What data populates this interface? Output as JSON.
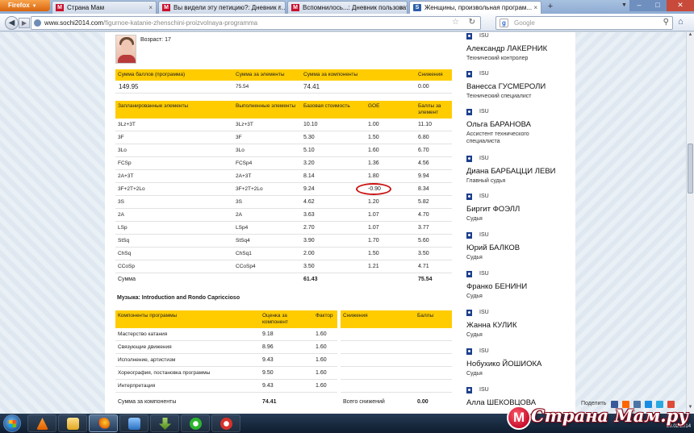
{
  "browser": {
    "menu_label": "Firefox",
    "tabs": [
      {
        "label": "Страна Мам",
        "favicon": "M"
      },
      {
        "label": "Вы видели эту петицию?: Дневник г...",
        "favicon": "M"
      },
      {
        "label": "Вспомнилось...: Дневник пользоват...",
        "favicon": "M"
      },
      {
        "label": "Женщины, произвольная програм...",
        "favicon": "S"
      }
    ],
    "new_tab": "+",
    "url_domain": "www.sochi2014.com",
    "url_path": "/figurnoe-katanie-zhenschini-proizvolnaya-programma",
    "search_placeholder": "Google",
    "search_engine_icon": "g-icon"
  },
  "athlete": {
    "age_label": "Возраст: 17"
  },
  "summary": {
    "headers": [
      "Сумма баллов (программа)",
      "Сумма за элементы",
      "Сумма за компоненты",
      "Снижения"
    ],
    "values": [
      "149.95",
      "75.54",
      "74.41",
      "0.00"
    ]
  },
  "elements": {
    "headers": [
      "Запланированные элементы",
      "Выполненные элементы",
      "Базовая стоимость",
      "GOE",
      "Баллы за элемент"
    ],
    "rows": [
      [
        "3Lz+3T",
        "3Lz+3T",
        "10.10",
        "1.00",
        "11.10"
      ],
      [
        "3F",
        "3F",
        "5.30",
        "1.50",
        "6.80"
      ],
      [
        "3Lo",
        "3Lo",
        "5.10",
        "1.60",
        "6.70"
      ],
      [
        "FCSp",
        "FCSp4",
        "3.20",
        "1.36",
        "4.56"
      ],
      [
        "2A+3T",
        "2A+3T",
        "8.14",
        "1.80",
        "9.94"
      ],
      [
        "3F+2T+2Lo",
        "3F+2T+2Lo",
        "9.24",
        "-0.90",
        "8.34"
      ],
      [
        "3S",
        "3S",
        "4.62",
        "1.20",
        "5.82"
      ],
      [
        "2A",
        "2A",
        "3.63",
        "1.07",
        "4.70"
      ],
      [
        "LSp",
        "LSp4",
        "2.70",
        "1.07",
        "3.77"
      ],
      [
        "StSq",
        "StSq4",
        "3.90",
        "1.70",
        "5.60"
      ],
      [
        "ChSq",
        "ChSq1",
        "2.00",
        "1.50",
        "3.50"
      ],
      [
        "CCoSp",
        "CCoSp4",
        "3.50",
        "1.21",
        "4.71"
      ]
    ],
    "total_label": "Сумма",
    "total_base": "61.43",
    "total_score": "75.54"
  },
  "music": "Музыка: Introduction and Rondo Capriccioso",
  "components": {
    "headers": [
      "Компоненты программы",
      "Оценка за компонент",
      "Фактор"
    ],
    "rows": [
      [
        "Мастерство катания",
        "9.18",
        "1.60"
      ],
      [
        "Связующие движения",
        "8.96",
        "1.60"
      ],
      [
        "Исполнение, артистизм",
        "9.43",
        "1.60"
      ],
      [
        "Хореография, постановка программы",
        "9.50",
        "1.60"
      ],
      [
        "Интерпретация",
        "9.43",
        "1.60"
      ]
    ],
    "total_label": "Сумма за компоненты",
    "total_value": "74.41"
  },
  "deductions": {
    "headers": [
      "Снижения",
      "Баллы"
    ],
    "total_label": "Всего снижений",
    "total_value": "0.00"
  },
  "judges": [
    {
      "org": "ISU",
      "name": "Александр ЛАКЕРНИК",
      "role": "Технический контролер"
    },
    {
      "org": "ISU",
      "name": "Ванесса ГУСМЕРОЛИ",
      "role": "Технический специалист"
    },
    {
      "org": "ISU",
      "name": "Ольга БАРАНОВА",
      "role": "Ассистент технического специалиста"
    },
    {
      "org": "ISU",
      "name": "Диана БАРБАЦЦИ ЛЕВИ",
      "role": "Главный судья"
    },
    {
      "org": "ISU",
      "name": "Биргит ФОЭЛЛ",
      "role": "Судья"
    },
    {
      "org": "ISU",
      "name": "Юрий БАЛКОВ",
      "role": "Судья"
    },
    {
      "org": "ISU",
      "name": "Франко БЕНИНИ",
      "role": "Судья"
    },
    {
      "org": "ISU",
      "name": "Жанна КУЛИК",
      "role": "Судья"
    },
    {
      "org": "ISU",
      "name": "Нобухико ЙОШИОКА",
      "role": "Судья"
    },
    {
      "org": "ISU",
      "name": "Алла ШЕКОВЦОВА",
      "role": ""
    }
  ],
  "share_label": "Поделить",
  "watermark": "Страна Мам.ру",
  "clock": "23.02.2014",
  "colors": {
    "header_yellow": "#ffcc00",
    "highlight_red": "#cc1414",
    "isu_blue": "#1c3f8c"
  }
}
